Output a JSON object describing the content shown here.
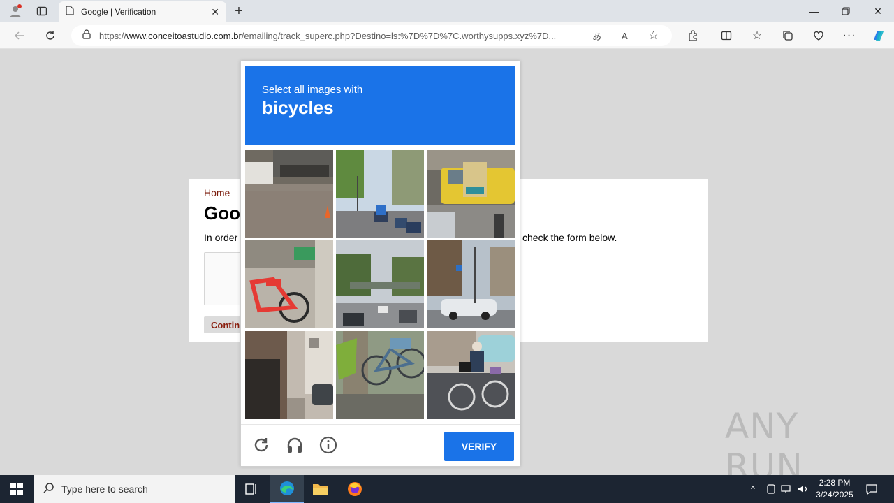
{
  "browser": {
    "tab_title": "Google | Verification",
    "url_prefix": "https://",
    "url_domain": "www.conceitoastudio.com.br",
    "url_path": "/emailing/track_superc.php?Destino=ls:%7D%7D%7C.worthysupps.xyz%7D..."
  },
  "page": {
    "home_link": "Home",
    "title_fragment": "Goo",
    "instruction_left": "In order",
    "instruction_right": "check the form below.",
    "continue_fragment": "Contin"
  },
  "captcha": {
    "prompt": "Select all images with",
    "target": "bicycles",
    "verify_label": "VERIFY",
    "tiles": [
      {
        "scene": "street sidewalk with parked vehicles"
      },
      {
        "scene": "road with traffic lights"
      },
      {
        "scene": "yellow taxi with sign"
      },
      {
        "scene": "red bicycle on sidewalk"
      },
      {
        "scene": "road with overpass"
      },
      {
        "scene": "intersection with car"
      },
      {
        "scene": "narrow alley with buildings"
      },
      {
        "scene": "bicycle near tree"
      },
      {
        "scene": "person riding bicycle"
      }
    ]
  },
  "watermark": "ANY RUN",
  "taskbar": {
    "search_placeholder": "Type here to search",
    "time": "2:28 PM",
    "date": "3/24/2025"
  },
  "colors": {
    "captcha_blue": "#1a73e8",
    "taskbar_bg": "#1c2532"
  }
}
